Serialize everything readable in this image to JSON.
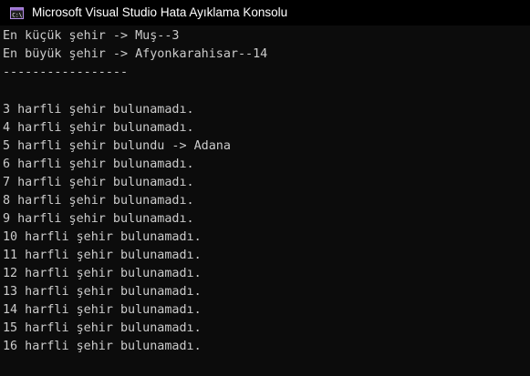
{
  "window": {
    "title": "Microsoft Visual Studio Hata Ayıklama Konsolu",
    "icon": "console-app-icon"
  },
  "console": {
    "lines": [
      "En küçük şehir -> Muş--3",
      "En büyük şehir -> Afyonkarahisar--14",
      "-----------------",
      "",
      "3 harfli şehir bulunamadı.",
      "4 harfli şehir bulunamadı.",
      "5 harfli şehir bulundu -> Adana",
      "6 harfli şehir bulunamadı.",
      "7 harfli şehir bulunamadı.",
      "8 harfli şehir bulunamadı.",
      "9 harfli şehir bulunamadı.",
      "10 harfli şehir bulunamadı.",
      "11 harfli şehir bulunamadı.",
      "12 harfli şehir bulunamadı.",
      "13 harfli şehir bulunamadı.",
      "14 harfli şehir bulunamadı.",
      "15 harfli şehir bulunamadı.",
      "16 harfli şehir bulunamadı."
    ]
  },
  "colors": {
    "background": "#0c0c0c",
    "titlebar": "#000000",
    "text": "#cccccc",
    "icon_accent": "#9b6fd1"
  }
}
